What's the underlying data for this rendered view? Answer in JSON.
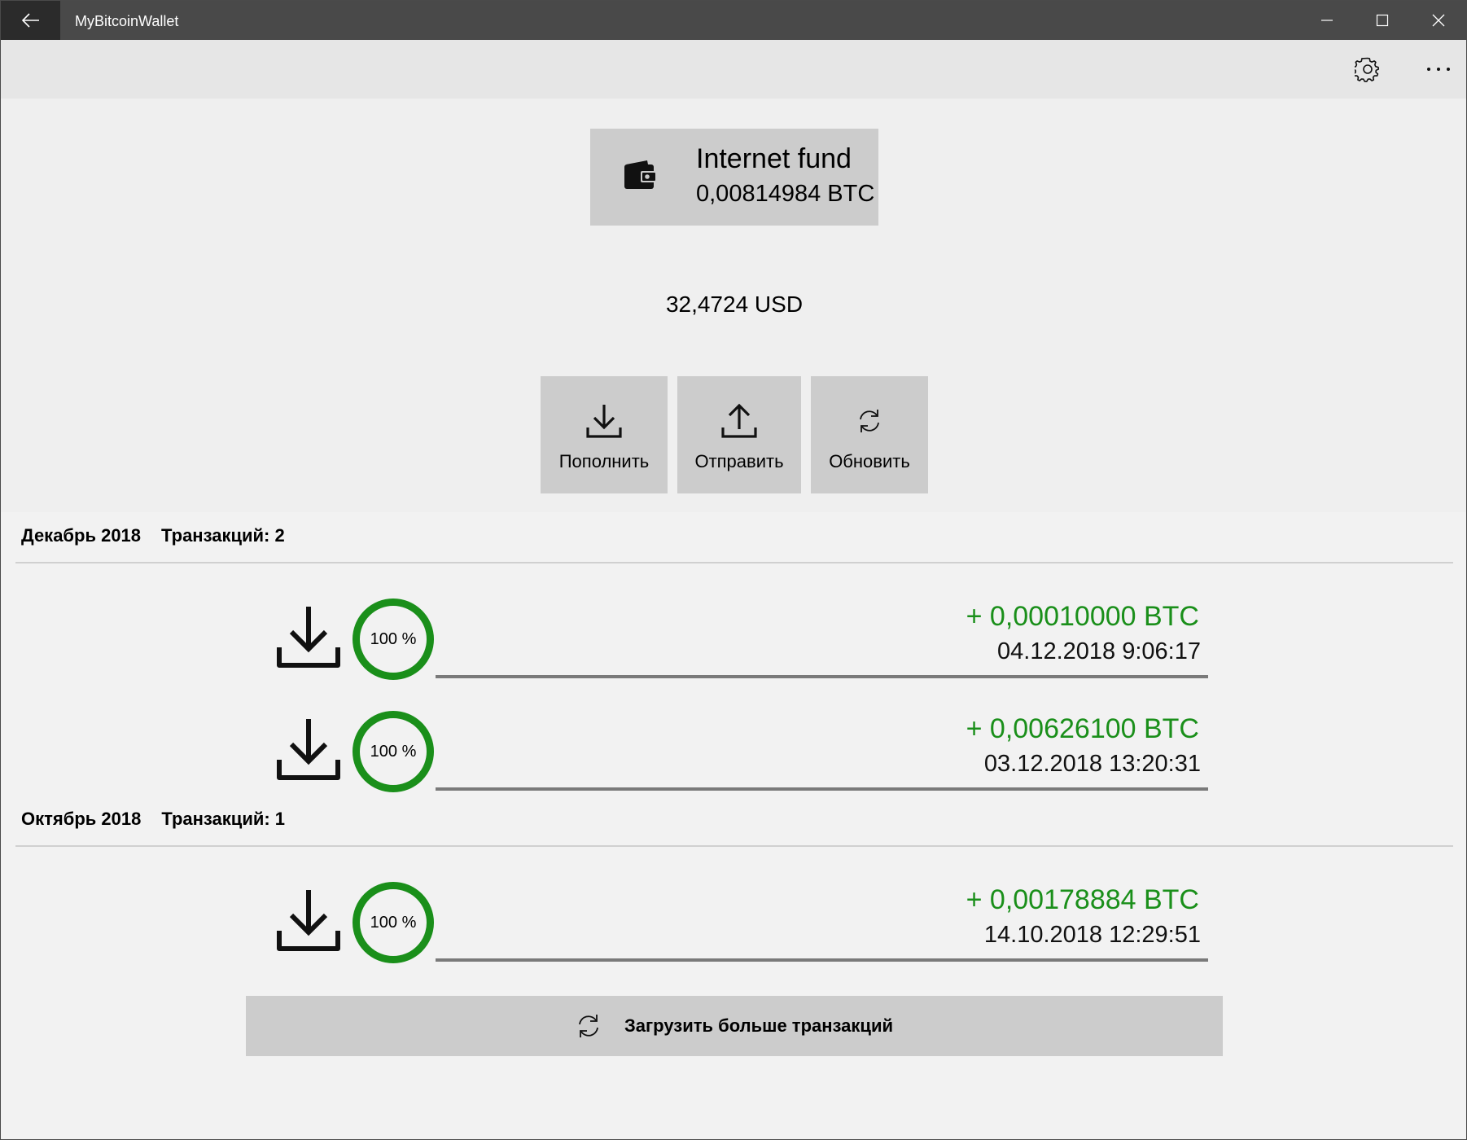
{
  "window": {
    "title": "MyBitcoinWallet",
    "back_icon": "back-arrow-icon",
    "controls": [
      "minimize-icon",
      "maximize-icon",
      "close-icon"
    ]
  },
  "commandbar": {
    "settings_icon": "gear-icon",
    "more_icon": "more-icon"
  },
  "wallet": {
    "icon": "wallet-icon",
    "name": "Internet fund",
    "balance_btc": "0,00814984 BTC",
    "balance_usd": "32,4724 USD"
  },
  "actions": [
    {
      "label": "Пополнить",
      "icon": "download-icon"
    },
    {
      "label": "Отправить",
      "icon": "upload-icon"
    },
    {
      "label": "Обновить",
      "icon": "refresh-icon"
    }
  ],
  "groups": [
    {
      "month": "Декабрь 2018",
      "count": "Транзакций: 2",
      "transactions": [
        {
          "progress": "100 %",
          "amount": "+ 0,00010000 BTC",
          "date": "04.12.2018 9:06:17"
        },
        {
          "progress": "100 %",
          "amount": "+ 0,00626100 BTC",
          "date": "03.12.2018 13:20:31"
        }
      ]
    },
    {
      "month": "Октябрь 2018",
      "count": "Транзакций: 1",
      "transactions": [
        {
          "progress": "100 %",
          "amount": "+ 0,00178884 BTC",
          "date": "14.10.2018 12:29:51"
        }
      ]
    }
  ],
  "load_more": {
    "label": "Загрузить больше транзакций",
    "icon": "refresh-icon"
  },
  "colors": {
    "accent_green": "#1a8f1a",
    "titlebar": "#494949",
    "button_bg": "#cccccc"
  }
}
